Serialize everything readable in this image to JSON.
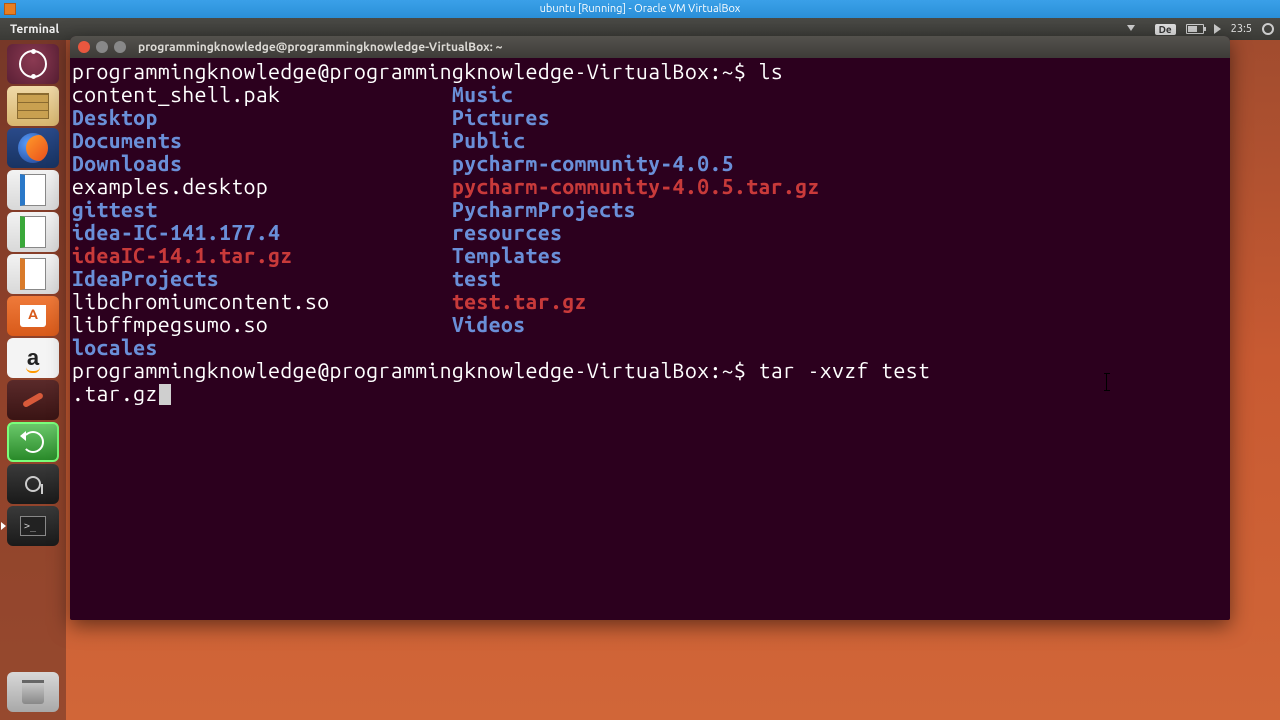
{
  "vbox": {
    "title": "ubuntu [Running] - Oracle VM VirtualBox"
  },
  "panel": {
    "active_app": "Terminal",
    "keyboard_layout": "De",
    "time": "23:5"
  },
  "launcher": {
    "items": [
      {
        "id": "dash",
        "name": "ubuntu-dash-icon"
      },
      {
        "id": "files",
        "name": "files-icon"
      },
      {
        "id": "firefox",
        "name": "firefox-icon"
      },
      {
        "id": "writer",
        "name": "libreoffice-writer-icon"
      },
      {
        "id": "calc",
        "name": "libreoffice-calc-icon"
      },
      {
        "id": "impress",
        "name": "libreoffice-impress-icon"
      },
      {
        "id": "software",
        "name": "ubuntu-software-icon"
      },
      {
        "id": "amazon",
        "name": "amazon-icon"
      },
      {
        "id": "settings",
        "name": "system-settings-icon"
      },
      {
        "id": "updater",
        "name": "software-updater-icon"
      },
      {
        "id": "keys",
        "name": "passwords-keys-icon"
      },
      {
        "id": "terminal",
        "name": "terminal-icon"
      }
    ],
    "trash": {
      "name": "trash-icon"
    }
  },
  "terminal": {
    "title": "programmingknowledge@programmingknowledge-VirtualBox: ~",
    "prompt": "programmingknowledge@programmingknowledge-VirtualBox:~$",
    "cmd_ls": "ls",
    "listing": {
      "col1": [
        {
          "text": "content_shell.pak",
          "class": "file"
        },
        {
          "text": "Desktop",
          "class": "dir"
        },
        {
          "text": "Documents",
          "class": "dir"
        },
        {
          "text": "Downloads",
          "class": "dir"
        },
        {
          "text": "examples.desktop",
          "class": "file"
        },
        {
          "text": "gittest",
          "class": "dir"
        },
        {
          "text": "idea-IC-141.177.4",
          "class": "dir"
        },
        {
          "text": "ideaIC-14.1.tar.gz",
          "class": "arch"
        },
        {
          "text": "IdeaProjects",
          "class": "dir"
        },
        {
          "text": "libchromiumcontent.so",
          "class": "file"
        },
        {
          "text": "libffmpegsumo.so",
          "class": "file"
        },
        {
          "text": "locales",
          "class": "dir"
        }
      ],
      "col2": [
        {
          "text": "Music",
          "class": "dir"
        },
        {
          "text": "Pictures",
          "class": "dir"
        },
        {
          "text": "Public",
          "class": "dir"
        },
        {
          "text": "pycharm-community-4.0.5",
          "class": "dir"
        },
        {
          "text": "pycharm-community-4.0.5.tar.gz",
          "class": "arch"
        },
        {
          "text": "PycharmProjects",
          "class": "dir"
        },
        {
          "text": "resources",
          "class": "dir"
        },
        {
          "text": "Templates",
          "class": "dir"
        },
        {
          "text": "test",
          "class": "dir"
        },
        {
          "text": "test.tar.gz",
          "class": "arch"
        },
        {
          "text": "Videos",
          "class": "dir"
        }
      ]
    },
    "cmd2_line1": "tar -xvzf test",
    "cmd2_line2": ".tar.gz"
  }
}
